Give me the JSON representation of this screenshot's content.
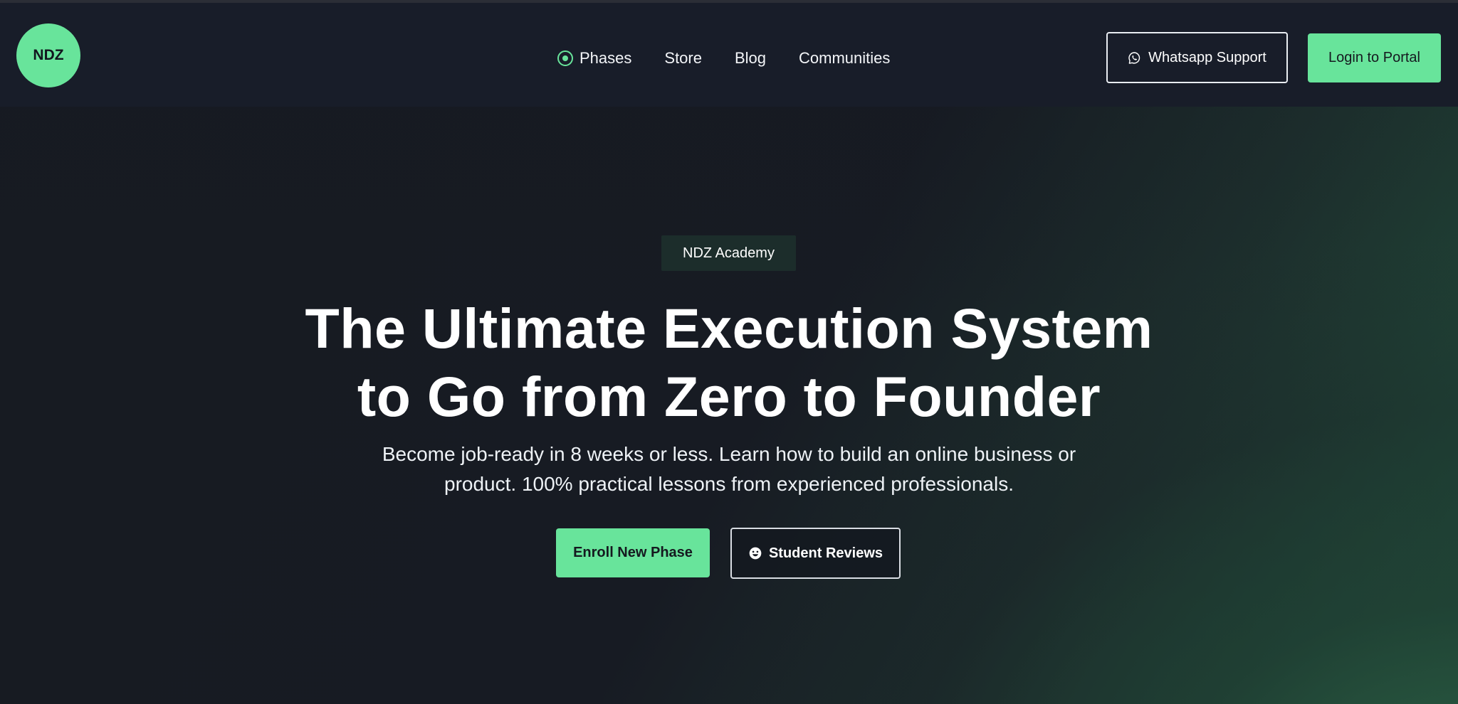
{
  "brand": {
    "logo_text": "NDZ",
    "accent": "#68e49b",
    "dark": "#161a22"
  },
  "nav": {
    "items": [
      {
        "label": "Phases",
        "icon": "radio-dot-icon"
      },
      {
        "label": "Store"
      },
      {
        "label": "Blog"
      },
      {
        "label": "Communities"
      }
    ],
    "whatsapp_label": "Whatsapp Support",
    "whatsapp_icon": "whatsapp-icon",
    "login_label": "Login to Portal"
  },
  "hero": {
    "badge": "NDZ Academy",
    "headline_line_1": "The Ultimate Execution System",
    "headline_line_2": "to Go from Zero to Founder",
    "subtitle_line_1": "Become job-ready in 8 weeks or less. Learn how to build an online business or",
    "subtitle_line_2": "product. 100% practical lessons from experienced professionals.",
    "primary_button": "Enroll New Phase",
    "secondary_button": "Student Reviews",
    "secondary_button_icon": "smiley-face-icon"
  }
}
